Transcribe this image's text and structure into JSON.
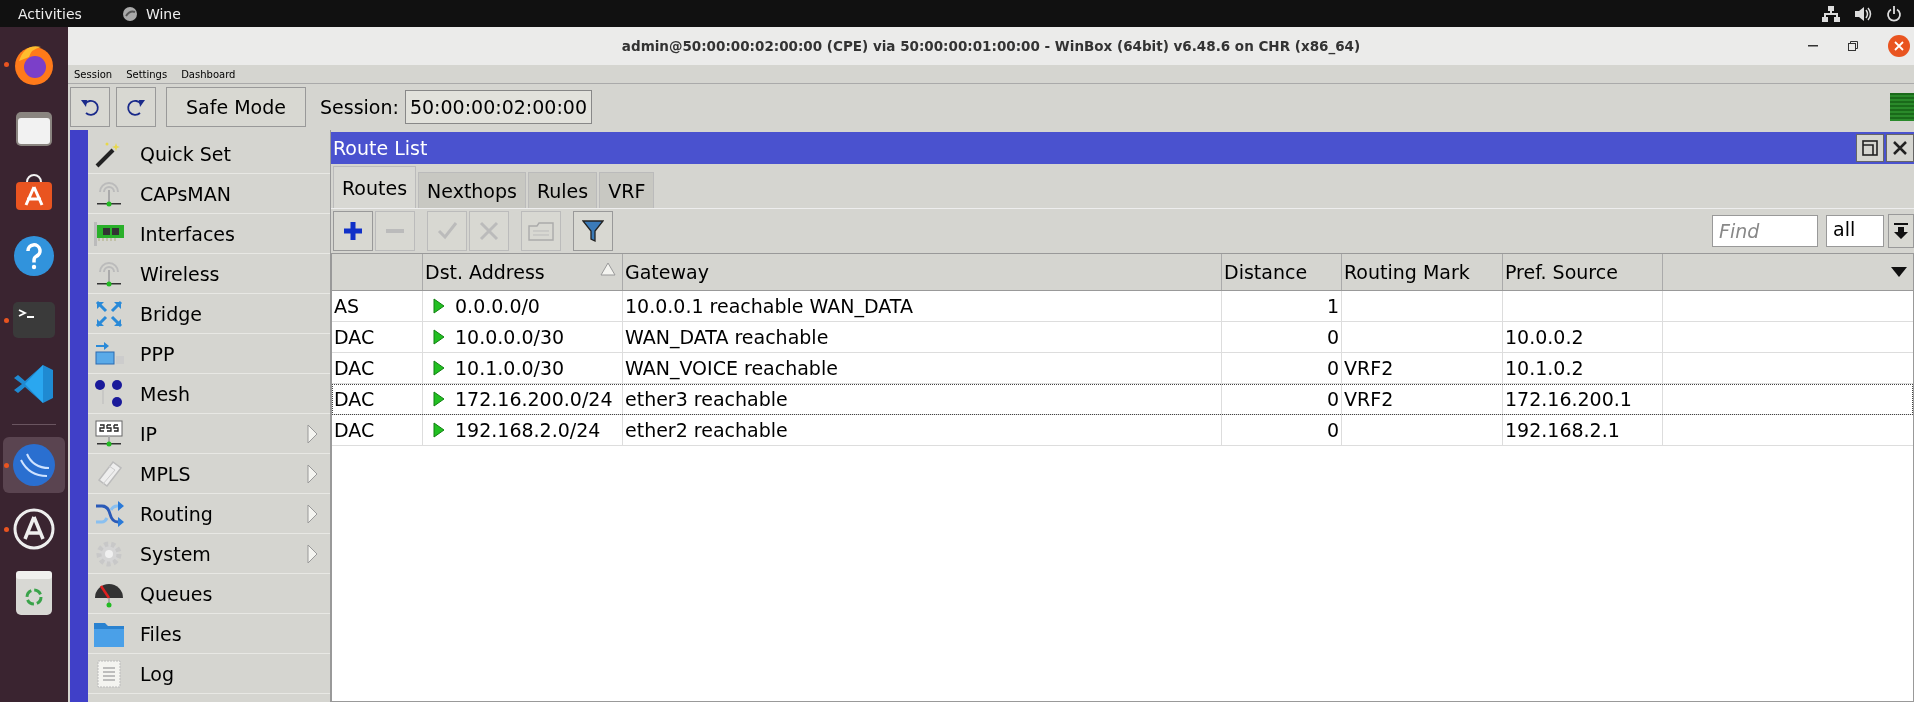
{
  "topbar": {
    "activities": "Activities",
    "app": "Wine"
  },
  "dock": [
    {
      "kind": "firefox",
      "running": true,
      "selected": false
    },
    {
      "kind": "files",
      "running": false,
      "selected": false
    },
    {
      "kind": "store",
      "running": false,
      "selected": false
    },
    {
      "kind": "help",
      "running": false,
      "selected": false
    },
    {
      "kind": "terminal",
      "running": true,
      "selected": false
    },
    {
      "kind": "vscode",
      "running": false,
      "selected": false
    },
    {
      "kind": "winbox",
      "running": true,
      "selected": true
    },
    {
      "kind": "updater",
      "running": true,
      "selected": false
    },
    {
      "kind": "trash",
      "running": false,
      "selected": false
    }
  ],
  "window": {
    "title": "admin@50:00:00:02:00:00 (CPE) via 50:00:00:01:00:00 - WinBox (64bit) v6.48.6 on CHR (x86_64)"
  },
  "menu": [
    "Session",
    "Settings",
    "Dashboard"
  ],
  "toolbar": {
    "safe_mode": "Safe Mode",
    "session_label": "Session:",
    "session_value": "50:00:00:02:00:00"
  },
  "sidebar": {
    "items": [
      {
        "kind": "wand",
        "label": "Quick Set",
        "submenu": false
      },
      {
        "kind": "antenna",
        "label": "CAPsMAN",
        "submenu": false
      },
      {
        "kind": "card",
        "label": "Interfaces",
        "submenu": false
      },
      {
        "kind": "antenna",
        "label": "Wireless",
        "submenu": false
      },
      {
        "kind": "bridge",
        "label": "Bridge",
        "submenu": false
      },
      {
        "kind": "ppp",
        "label": "PPP",
        "submenu": false
      },
      {
        "kind": "mesh",
        "label": "Mesh",
        "submenu": false
      },
      {
        "kind": "ip",
        "label": "IP",
        "submenu": true
      },
      {
        "kind": "tag",
        "label": "MPLS",
        "submenu": true
      },
      {
        "kind": "routing",
        "label": "Routing",
        "submenu": true
      },
      {
        "kind": "gear",
        "label": "System",
        "submenu": true
      },
      {
        "kind": "gauge",
        "label": "Queues",
        "submenu": false
      },
      {
        "kind": "folder",
        "label": "Files",
        "submenu": false
      },
      {
        "kind": "log",
        "label": "Log",
        "submenu": false
      }
    ]
  },
  "route_list": {
    "title": "Route List",
    "tabs": [
      {
        "label": "Routes",
        "selected": true
      },
      {
        "label": "Nexthops",
        "selected": false
      },
      {
        "label": "Rules",
        "selected": false
      },
      {
        "label": "VRF",
        "selected": false
      }
    ],
    "tools": [
      {
        "kind": "add",
        "disabled": false
      },
      {
        "kind": "remove",
        "disabled": true
      },
      {
        "kind": "enable",
        "disabled": true
      },
      {
        "kind": "disable",
        "disabled": true
      },
      {
        "kind": "comment",
        "disabled": true
      },
      {
        "kind": "filter",
        "disabled": false
      }
    ],
    "find": {
      "placeholder": "Find"
    },
    "scope": "all",
    "table": {
      "columns": [
        "",
        "Dst. Address",
        "Gateway",
        "Distance",
        "Routing Mark",
        "Pref. Source"
      ],
      "rows": [
        {
          "flags": "AS",
          "dst": "0.0.0.0/0",
          "gateway": "10.0.0.1 reachable WAN_DATA",
          "distance": "1",
          "routing_mark": "",
          "pref_source": "",
          "focused": false
        },
        {
          "flags": "DAC",
          "dst": "10.0.0.0/30",
          "gateway": "WAN_DATA reachable",
          "distance": "0",
          "routing_mark": "",
          "pref_source": "10.0.0.2",
          "focused": false
        },
        {
          "flags": "DAC",
          "dst": "10.1.0.0/30",
          "gateway": "WAN_VOICE reachable",
          "distance": "0",
          "routing_mark": "VRF2",
          "pref_source": "10.1.0.2",
          "focused": false
        },
        {
          "flags": "DAC",
          "dst": "172.16.200.0/24",
          "gateway": "ether3 reachable",
          "distance": "0",
          "routing_mark": "VRF2",
          "pref_source": "172.16.200.1",
          "focused": true
        },
        {
          "flags": "DAC",
          "dst": "192.168.2.0/24",
          "gateway": "ether2 reachable",
          "distance": "0",
          "routing_mark": "",
          "pref_source": "192.168.2.1",
          "focused": false
        }
      ]
    }
  }
}
